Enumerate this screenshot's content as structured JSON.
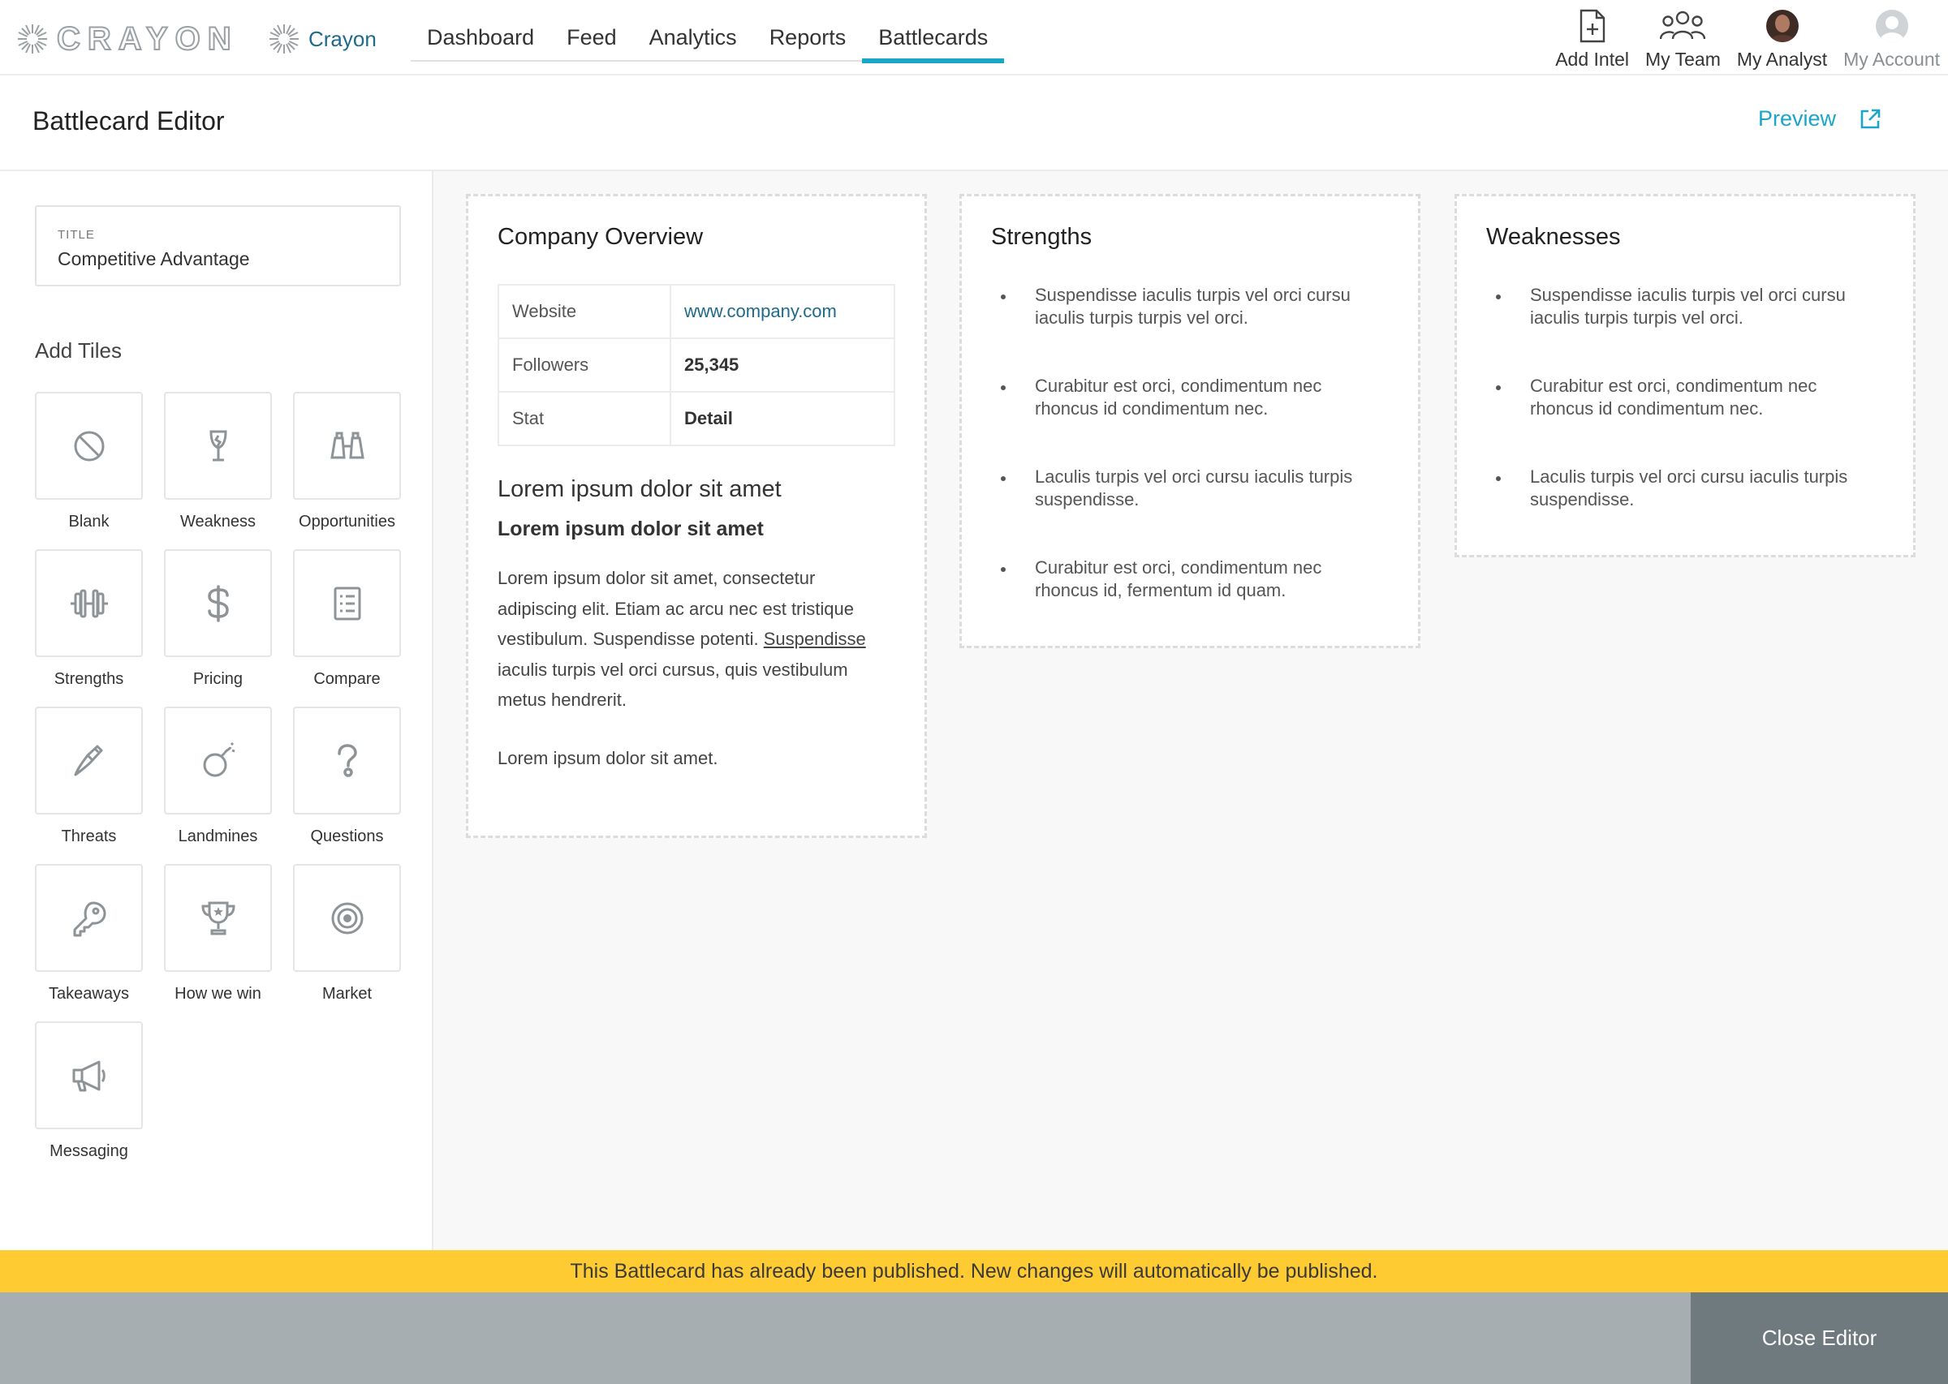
{
  "brand": {
    "logo_text": "CRAYON",
    "workspace": "Crayon"
  },
  "nav": {
    "tabs": [
      {
        "label": "Dashboard"
      },
      {
        "label": "Feed"
      },
      {
        "label": "Analytics"
      },
      {
        "label": "Reports"
      },
      {
        "label": "Battlecards"
      }
    ],
    "active": "Battlecards"
  },
  "user_nav": {
    "add_intel": "Add Intel",
    "my_team": "My Team",
    "my_analyst": "My Analyst",
    "my_account": "My Account"
  },
  "editor": {
    "title": "Battlecard Editor",
    "preview": "Preview"
  },
  "sidebar": {
    "title_caption": "TITLE",
    "title_value": "Competitive Advantage",
    "add_tiles": "Add Tiles",
    "tiles": [
      {
        "label": "Blank",
        "icon": "ban-icon"
      },
      {
        "label": "Weakness",
        "icon": "broken-glass-icon"
      },
      {
        "label": "Opportunities",
        "icon": "binoculars-icon"
      },
      {
        "label": "Strengths",
        "icon": "dumbbell-icon"
      },
      {
        "label": "Pricing",
        "icon": "dollar-icon"
      },
      {
        "label": "Compare",
        "icon": "checklist-icon"
      },
      {
        "label": "Threats",
        "icon": "knife-icon"
      },
      {
        "label": "Landmines",
        "icon": "bomb-icon"
      },
      {
        "label": "Questions",
        "icon": "question-icon"
      },
      {
        "label": "Takeaways",
        "icon": "key-icon"
      },
      {
        "label": "How we win",
        "icon": "trophy-icon"
      },
      {
        "label": "Market",
        "icon": "target-icon"
      },
      {
        "label": "Messaging",
        "icon": "megaphone-icon"
      }
    ]
  },
  "overview": {
    "title": "Company Overview",
    "rows": [
      {
        "key": "Website",
        "value": "www.company.com"
      },
      {
        "key": "Followers",
        "value": "25,345"
      },
      {
        "key": "Stat",
        "value": "Detail"
      }
    ],
    "heading1": "Lorem ipsum dolor sit amet",
    "heading2": "Lorem ipsum dolor sit amet",
    "para_a": "Lorem ipsum dolor sit amet, consectetur adipiscing elit. Etiam ac arcu nec est tristique vestibulum. Suspendisse potenti. ",
    "para_link": "Suspendisse",
    "para_b": " iaculis turpis vel orci cursus, quis vestibulum metus hendrerit.",
    "para2": "Lorem ipsum dolor sit amet."
  },
  "strengths": {
    "title": "Strengths",
    "items": [
      "Suspendisse iaculis turpis vel orci cursu iaculis turpis turpis vel orci.",
      "Curabitur est orci, condimentum nec rhoncus id condimentum nec.",
      "Laculis turpis vel orci cursu iaculis turpis suspendisse.",
      "Curabitur est orci, condimentum nec rhoncus id, fermentum id quam."
    ]
  },
  "weaknesses": {
    "title": "Weaknesses",
    "items": [
      "Suspendisse iaculis turpis vel orci cursu iaculis turpis turpis vel orci.",
      "Curabitur est orci, condimentum nec rhoncus id condimentum nec.",
      "Laculis turpis vel orci cursu iaculis turpis suspendisse."
    ]
  },
  "banner": "This Battlecard has already been published. New changes will automatically be published.",
  "footer": {
    "close": "Close Editor"
  },
  "colors": {
    "accent": "#1aa6c9",
    "link": "#1d6a8c",
    "banner": "#fecb33",
    "footer": "#a6aeb1",
    "close_button": "#6f7a7e"
  }
}
